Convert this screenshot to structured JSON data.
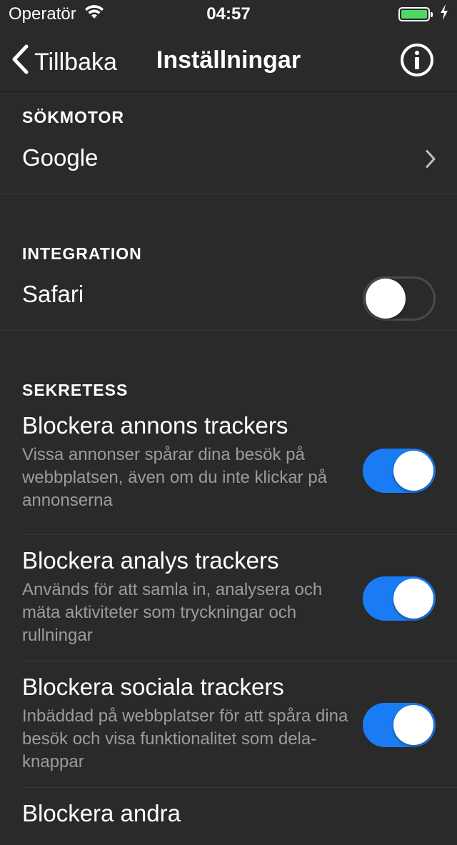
{
  "status_bar": {
    "carrier": "Operatör",
    "time": "04:57",
    "battery_color": "#4cd964"
  },
  "nav": {
    "back_label": "Tillbaka",
    "title": "Inställningar",
    "info_icon": "info-circle-icon"
  },
  "search_engine": {
    "header": "SÖKMOTOR",
    "value": "Google"
  },
  "integration": {
    "header": "INTEGRATION",
    "safari_label": "Safari",
    "safari_enabled": false
  },
  "privacy": {
    "header": "SEKRETESS",
    "items": [
      {
        "title": "Blockera annons trackers",
        "description": "Vissa annonser spårar dina besök på webbplatsen, även om du inte klickar på annonserna",
        "enabled": true
      },
      {
        "title": "Blockera analys trackers",
        "description": "Används för att samla in, analysera och mäta aktiviteter som tryckningar och rullningar",
        "enabled": true
      },
      {
        "title": "Blockera sociala trackers",
        "description": "Inbäddad på webbplatser för att spåra dina besök och visa funktionalitet som dela-knappar",
        "enabled": true
      },
      {
        "title": "Blockera andra"
      }
    ]
  },
  "colors": {
    "background": "#2a2a2a",
    "toggle_on": "#1a7cf5",
    "secondary_text": "#9c9c9c"
  }
}
